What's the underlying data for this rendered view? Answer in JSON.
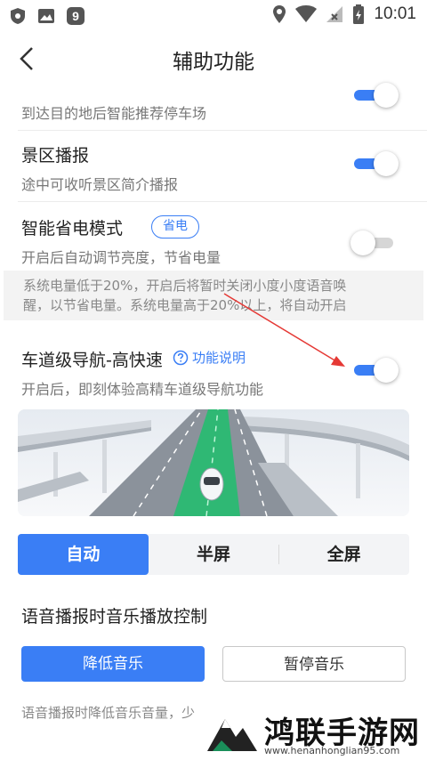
{
  "status_bar": {
    "time": "10:01",
    "left_icons": [
      "shield-icon",
      "image-icon",
      "app-9-icon"
    ],
    "right_icons": [
      "location-icon",
      "wifi-icon",
      "no-signal-icon",
      "battery-icon"
    ]
  },
  "header": {
    "title": "辅助功能",
    "back_icon": "chevron-left-icon"
  },
  "settings": {
    "parking": {
      "subtitle": "到达目的地后智能推荐停车场",
      "enabled": true
    },
    "scenic": {
      "title": "景区播报",
      "subtitle": "途中可收听景区简介播报",
      "enabled": true
    },
    "power_saving": {
      "title": "智能省电模式",
      "badge": "省电",
      "subtitle": "开启后自动调节亮度，节省电量",
      "enabled": false,
      "notice_line1": "系统电量低于20%，开启后将暂时关闭小度小度语音唤",
      "notice_line2": "醒，以节省电量。系统电量高于20%以上，将自动开启"
    },
    "lane_navigation": {
      "title": "车道级导航-高快速",
      "help_link": "功能说明",
      "subtitle": "开启后，即刻体验高精车道级导航功能",
      "enabled": true
    }
  },
  "display_mode": {
    "options": [
      "自动",
      "半屏",
      "全屏"
    ],
    "selected": "自动"
  },
  "music_control": {
    "title": "语音播报时音乐播放控制",
    "lower_button": "降低音乐",
    "pause_button": "暂停音乐",
    "selected": "降低音乐",
    "description": "语音播报时降低音乐音量，少"
  },
  "watermark": {
    "text": "鸿联手游网",
    "url": "www.henanhonglian95.com"
  },
  "colors": {
    "accent": "#3a7ef5",
    "arrow": "#e53935"
  }
}
